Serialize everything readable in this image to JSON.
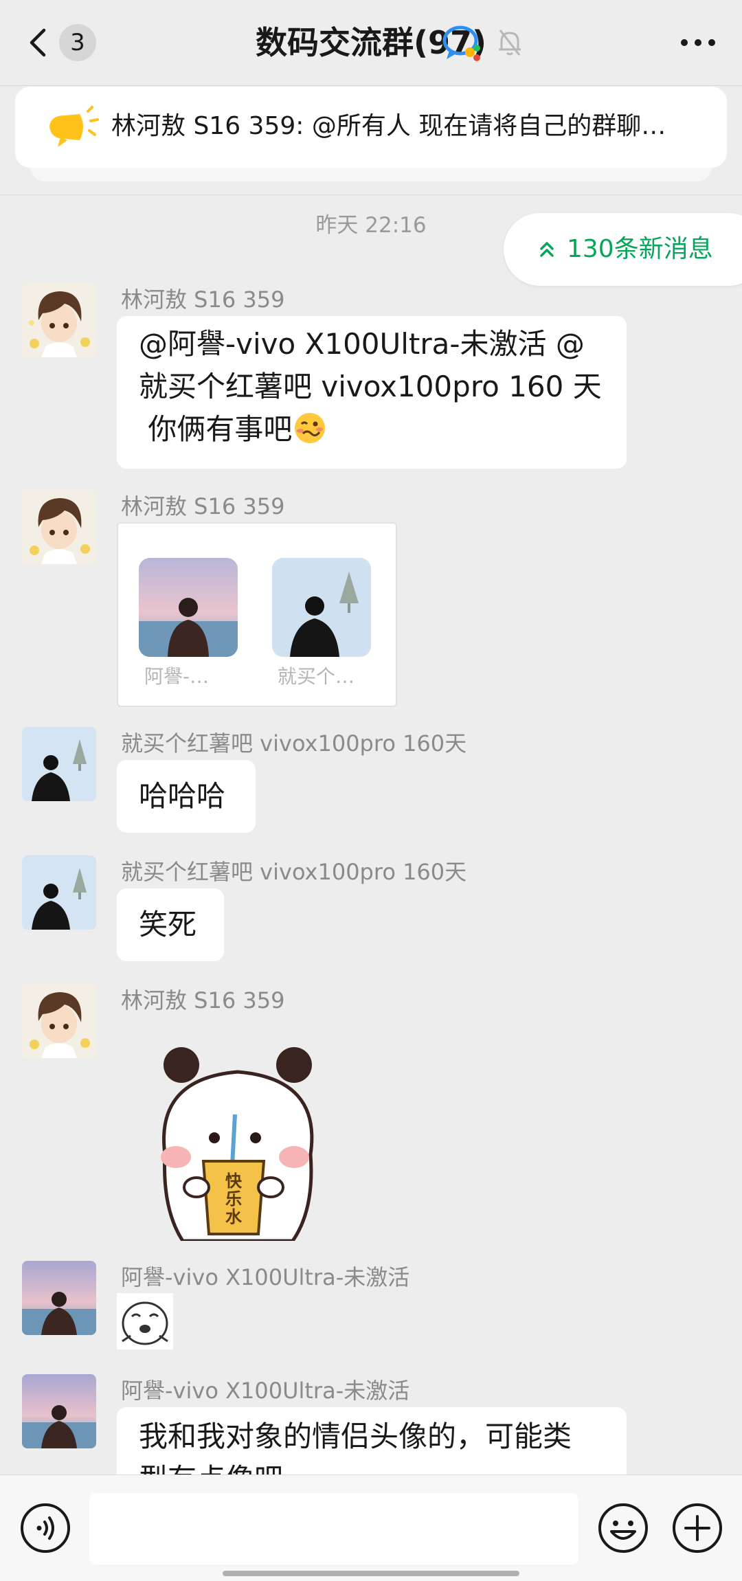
{
  "header": {
    "back_badge": "3",
    "title": "数码交流群(97)"
  },
  "announcement": {
    "text": "林河敖 S16 359: @所有人 现在请将自己的群聊…"
  },
  "chat": {
    "timestamp": "昨天 22:16",
    "new_messages": "130条新消息",
    "messages": [
      {
        "sender": "林河敖 S16 359",
        "lines": [
          "@阿譽-vivo X100Ultra-未激活  @",
          "就买个红薯吧 vivox100pro 160 天",
          " 你俩有事吧"
        ],
        "emoji": "woozy-face"
      },
      {
        "sender": "林河敖 S16 359",
        "card": {
          "left_label": "阿譽-…",
          "right_label": "就买个…"
        }
      },
      {
        "sender": "就买个红薯吧 vivox100pro 160天",
        "text": "哈哈哈"
      },
      {
        "sender": "就买个红薯吧 vivox100pro 160天",
        "text": "笑死"
      },
      {
        "sender": "林河敖 S16 359",
        "sticker_text": "快\n乐\n水",
        "sticker_line1": "快",
        "sticker_line2": "乐",
        "sticker_line3": "水"
      },
      {
        "sender": "阿譽-vivo X100Ultra-未激活"
      },
      {
        "sender": "阿譽-vivo X100Ultra-未激活",
        "lines": [
          "我和我对象的情侣头像的，可能类",
          "型有点像吧"
        ]
      }
    ]
  },
  "input": {
    "value": ""
  },
  "colors": {
    "background": "#ededed",
    "accent_green": "#07a55a",
    "bubble": "#ffffff"
  },
  "icons": [
    "back-arrow-icon",
    "group-chat-icon",
    "mute-bell-icon",
    "more-dots-icon",
    "speaker-icon",
    "double-up-chevron-icon",
    "voice-icon",
    "emoji-icon",
    "plus-icon"
  ]
}
